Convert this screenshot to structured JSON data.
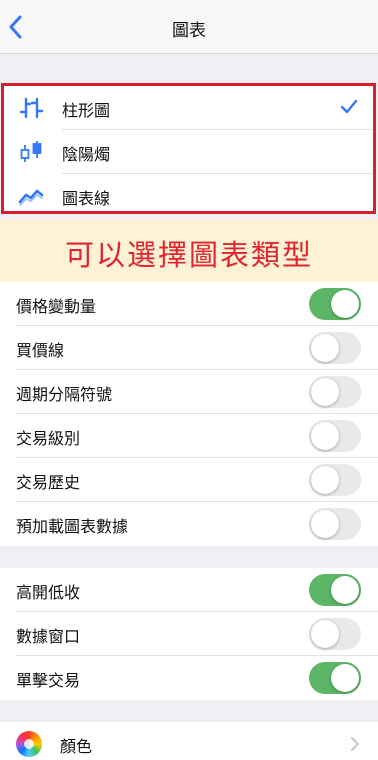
{
  "nav": {
    "title": "圖表",
    "back_icon": "chevron-left-icon"
  },
  "chart_types": [
    {
      "label": "柱形圖",
      "icon": "bar-chart-icon",
      "selected": true
    },
    {
      "label": "陰陽燭",
      "icon": "candlestick-icon",
      "selected": false
    },
    {
      "label": "圖表線",
      "icon": "line-chart-icon",
      "selected": false
    }
  ],
  "banner": {
    "text": "可以選擇圖表類型"
  },
  "group1": [
    {
      "label": "價格變動量",
      "on": true
    },
    {
      "label": "買價線",
      "on": false
    },
    {
      "label": "週期分隔符號",
      "on": false
    },
    {
      "label": "交易級別",
      "on": false
    },
    {
      "label": "交易歷史",
      "on": false
    },
    {
      "label": "預加載圖表數據",
      "on": false
    }
  ],
  "group2": [
    {
      "label": "高開低收",
      "on": true
    },
    {
      "label": "數據窗口",
      "on": false
    },
    {
      "label": "單擊交易",
      "on": true
    }
  ],
  "color_setting": {
    "label": "顏色",
    "icon": "color-wheel-icon"
  },
  "colors": {
    "accent": "#3478f6",
    "toggle_on": "#5bb767",
    "banner_text": "#e0252f",
    "banner_bg": "#fdf1d6",
    "highlight_border": "#d61f2b"
  }
}
